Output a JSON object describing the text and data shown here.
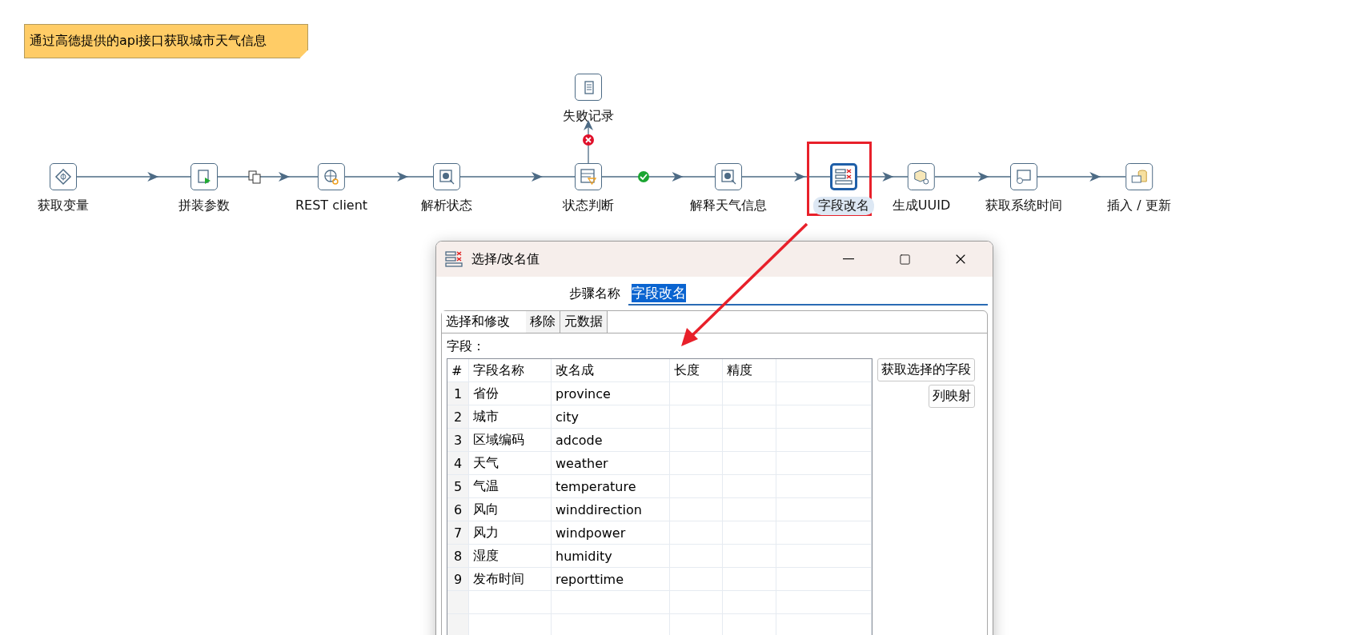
{
  "note": {
    "text": "通过高德提供的api接口获取城市天气信息"
  },
  "steps": [
    {
      "label": "获取变量",
      "kind": "variable",
      "selected": false
    },
    {
      "label": "拼装参数",
      "kind": "script",
      "selected": false
    },
    {
      "label": "REST client",
      "kind": "rest",
      "selected": false
    },
    {
      "label": "解析状态",
      "kind": "json",
      "selected": false
    },
    {
      "label": "状态判断",
      "kind": "filter",
      "selected": false
    },
    {
      "label": "解释天气信息",
      "kind": "json",
      "selected": false
    },
    {
      "label": "字段改名",
      "kind": "select",
      "selected": true
    },
    {
      "label": "生成UUID",
      "kind": "uuid",
      "selected": false
    },
    {
      "label": "获取系统时间",
      "kind": "sysinfo",
      "selected": false
    },
    {
      "label": "插入 / 更新",
      "kind": "db",
      "selected": false
    }
  ],
  "error_step": {
    "label": "失败记录",
    "kind": "file",
    "selected": false
  },
  "dialog": {
    "title": "选择/改名值",
    "step_name_label": "步骤名称",
    "step_name_value": "字段改名",
    "tabs": [
      {
        "label": "选择和修改",
        "selected": true
      },
      {
        "label": "移除",
        "selected": false
      },
      {
        "label": "元数据",
        "selected": false
      }
    ],
    "fields_label": "字段：",
    "columns": [
      "#",
      "字段名称",
      "改名成",
      "长度",
      "精度"
    ],
    "rows": [
      {
        "number": "1",
        "name": "省份",
        "rename": "province"
      },
      {
        "number": "2",
        "name": "城市",
        "rename": "city"
      },
      {
        "number": "3",
        "name": "区域编码",
        "rename": "adcode"
      },
      {
        "number": "4",
        "name": "天气",
        "rename": "weather"
      },
      {
        "number": "5",
        "name": "气温",
        "rename": "temperature"
      },
      {
        "number": "6",
        "name": "风向",
        "rename": "winddirection"
      },
      {
        "number": "7",
        "name": "风力",
        "rename": "windpower"
      },
      {
        "number": "8",
        "name": "湿度",
        "rename": "humidity"
      },
      {
        "number": "9",
        "name": "发布时间",
        "rename": "reporttime"
      }
    ],
    "buttons": [
      "获取选择的字段",
      "列映射"
    ]
  }
}
